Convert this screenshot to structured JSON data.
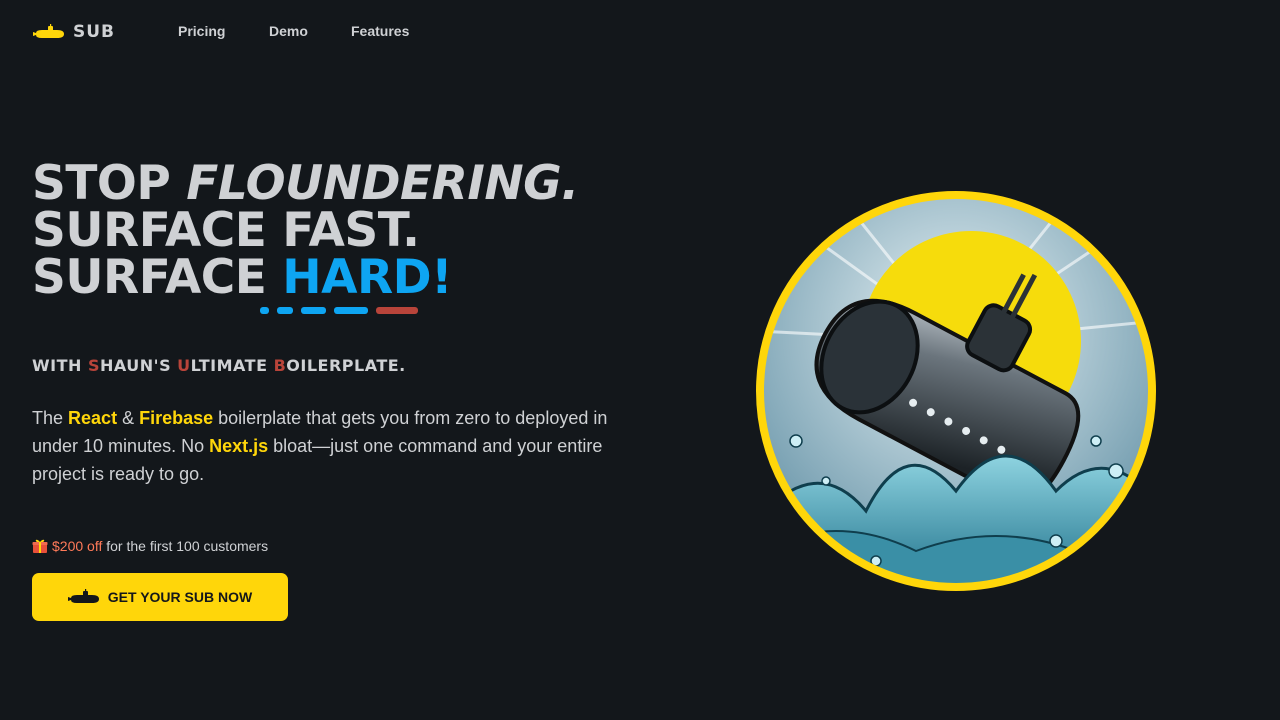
{
  "nav": {
    "logo_text": "SUB",
    "links": [
      "Pricing",
      "Demo",
      "Features"
    ]
  },
  "hero": {
    "headline": {
      "line1_a": "STOP ",
      "line1_b": "FLOUNDERING.",
      "line2": "SURFACE FAST.",
      "line3_a": "SURFACE ",
      "line3_b": "HARD!"
    },
    "subline": {
      "p1": "WITH ",
      "s": "S",
      "p2": "HAUN'S ",
      "u": "U",
      "p3": "LTIMATE ",
      "b": "B",
      "p4": "OILERPLATE."
    },
    "description": {
      "t1": "The ",
      "react": "React",
      "t2": " & ",
      "firebase": "Firebase",
      "t3": " boilerplate that gets you from zero to deployed in under 10 minutes. No ",
      "nextjs": "Next.js",
      "t4": " bloat—just one command and your entire project is ready to go."
    },
    "offer": {
      "price": "$200 off",
      "rest": " for the first 100 customers"
    },
    "cta_label": "GET YOUR SUB NOW"
  },
  "colors": {
    "background": "#13171b",
    "accent_yellow": "#ffd60a",
    "accent_blue": "#0ea5f2",
    "accent_red": "#b8443a"
  },
  "icons": [
    "submarine-icon",
    "gift-icon"
  ]
}
